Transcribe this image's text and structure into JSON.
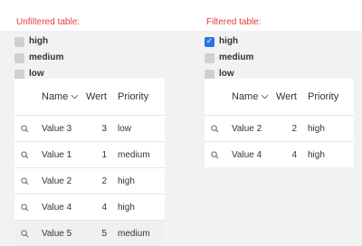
{
  "left": {
    "title": "Unfiltered table:",
    "filters": [
      {
        "label": "high",
        "checked": false
      },
      {
        "label": "medium",
        "checked": false
      },
      {
        "label": "low",
        "checked": false
      }
    ],
    "headers": {
      "name": "Name",
      "wert": "Wert",
      "priority": "Priority"
    },
    "rows": [
      {
        "name": "Value 3",
        "wert": "3",
        "priority": "low"
      },
      {
        "name": "Value 1",
        "wert": "1",
        "priority": "medium"
      },
      {
        "name": "Value 2",
        "wert": "2",
        "priority": "high"
      },
      {
        "name": "Value 4",
        "wert": "4",
        "priority": "high"
      },
      {
        "name": "Value 5",
        "wert": "5",
        "priority": "medium"
      }
    ]
  },
  "right": {
    "title": "Filtered table:",
    "filters": [
      {
        "label": "high",
        "checked": true
      },
      {
        "label": "medium",
        "checked": false
      },
      {
        "label": "low",
        "checked": false
      }
    ],
    "headers": {
      "name": "Name",
      "wert": "Wert",
      "priority": "Priority"
    },
    "rows": [
      {
        "name": "Value 2",
        "wert": "2",
        "priority": "high"
      },
      {
        "name": "Value 4",
        "wert": "4",
        "priority": "high"
      }
    ]
  },
  "icons": {
    "search": "search-icon",
    "sort": "chevron-down-icon",
    "check": "checkmark-icon"
  },
  "colors": {
    "title": "#e53b3b",
    "checkbox_checked": "#2a72e6",
    "checkbox_unchecked": "#d0d0d0"
  }
}
